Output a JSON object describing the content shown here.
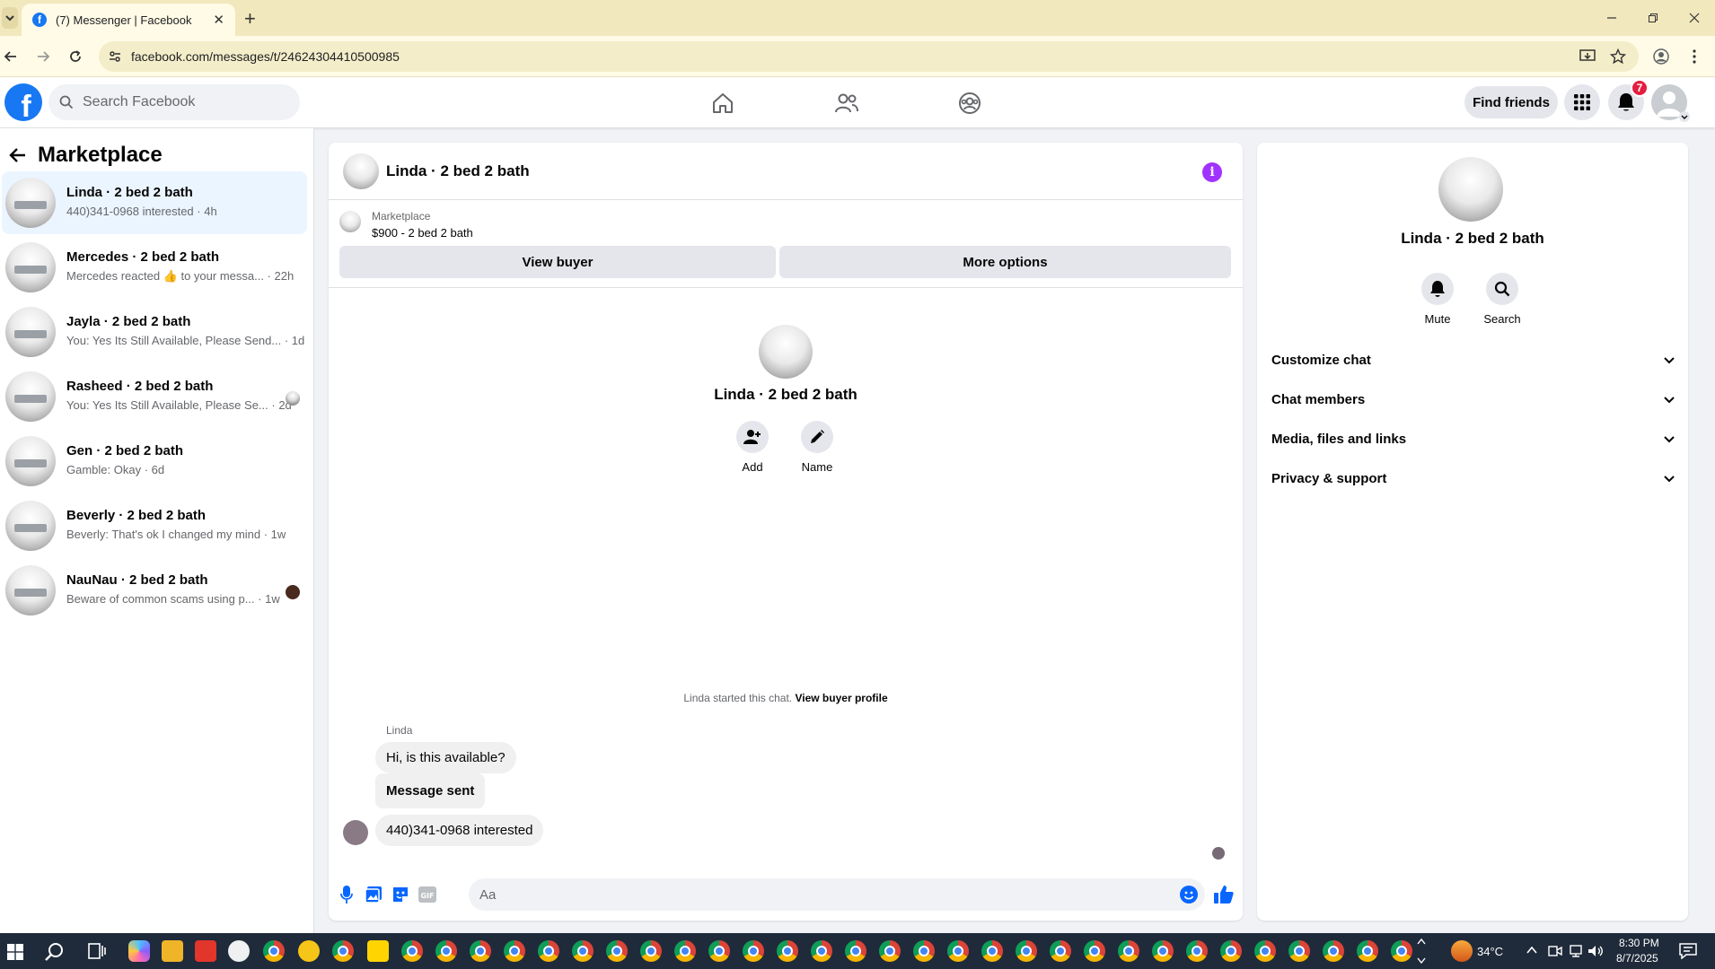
{
  "browser": {
    "tab_title": "(7) Messenger | Facebook",
    "url": "facebook.com/messages/t/24624304410500985"
  },
  "header": {
    "search_placeholder": "Search Facebook",
    "find_friends_label": "Find friends",
    "notification_count": "7"
  },
  "sidebar": {
    "title": "Marketplace",
    "chats": [
      {
        "name": "Linda · 2 bed 2 bath",
        "preview": "440)341-0968 interested · 4h",
        "active": true
      },
      {
        "name": "Mercedes · 2 bed 2 bath",
        "preview": "Mercedes reacted 👍 to your messa... · 22h"
      },
      {
        "name": "Jayla · 2 bed 2 bath",
        "preview": "You: Yes Its Still Available, Please Send... · 1d"
      },
      {
        "name": "Rasheed · 2 bed 2 bath",
        "preview": "You: Yes Its Still Available, Please Se... · 2d"
      },
      {
        "name": "Gen · 2 bed 2 bath",
        "preview": "Gamble: Okay · 6d"
      },
      {
        "name": "Beverly · 2 bed 2 bath",
        "preview": "Beverly: That's ok I changed my mind · 1w"
      },
      {
        "name": "NauNau · 2 bed 2 bath",
        "preview": "Beware of common scams using p... · 1w"
      }
    ]
  },
  "chat": {
    "title": "Linda · 2 bed 2 bath",
    "marketplace_label": "Marketplace",
    "listing": "$900 - 2 bed 2 bath",
    "view_buyer_label": "View buyer",
    "more_options_label": "More options",
    "hero_name": "Linda · 2 bed 2 bath",
    "add_label": "Add",
    "name_label": "Name",
    "started_text": "Linda started this chat.",
    "view_profile_link": "View buyer profile",
    "sender": "Linda",
    "messages": [
      "Hi, is this available?",
      "Message sent",
      "440)341-0968 interested"
    ],
    "composer_placeholder": "Aa"
  },
  "details": {
    "name": "Linda · 2 bed 2 bath",
    "mute_label": "Mute",
    "search_label": "Search",
    "sections": [
      "Customize chat",
      "Chat members",
      "Media, files and links",
      "Privacy & support"
    ]
  },
  "taskbar": {
    "temperature": "34°C",
    "time": "8:30 PM",
    "date": "8/7/2025"
  },
  "colors": {
    "facebook_blue": "#1877f2",
    "active_chat_bg": "#ebf5ff",
    "info_purple": "#a033ff",
    "badge_red": "#e41e3f"
  }
}
